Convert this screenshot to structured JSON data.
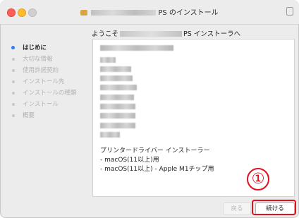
{
  "window": {
    "title_suffix": "PS のインストール"
  },
  "heading": {
    "prefix": "ようこそ",
    "suffix": "PS インストーラへ"
  },
  "sidebar": {
    "steps": [
      {
        "label": "はじめに",
        "active": true
      },
      {
        "label": "大切な情報",
        "active": false
      },
      {
        "label": "使用許諾契約",
        "active": false
      },
      {
        "label": "インストール先",
        "active": false
      },
      {
        "label": "インストールの種類",
        "active": false
      },
      {
        "label": "インストール",
        "active": false
      },
      {
        "label": "概要",
        "active": false
      }
    ]
  },
  "content": {
    "description_lines": [
      "プリンタードライバー インストーラー",
      " - macOS(11以上)用",
      " - macOS(11以上) - Apple M1チップ用"
    ]
  },
  "annotation": {
    "number": "①"
  },
  "buttons": {
    "back": "戻る",
    "continue": "続ける"
  },
  "colors": {
    "accent": "#2f7cf6",
    "annotation": "#e0101f",
    "close": "#ff5f57",
    "minimize": "#febc2e"
  },
  "icons": [
    "close-button-icon",
    "minimize-button-icon",
    "zoom-button-icon",
    "package-icon",
    "lock-icon"
  ]
}
